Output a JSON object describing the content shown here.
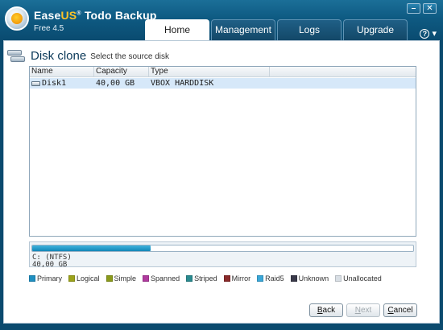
{
  "app": {
    "name_pre": "Ease",
    "name_accent": "US",
    "name_post": "Todo Backup",
    "version": "Free 4.5"
  },
  "window": {
    "minimize": "–",
    "close": "✕"
  },
  "tabs": [
    {
      "label": "Home",
      "active": true
    },
    {
      "label": "Management",
      "active": false
    },
    {
      "label": "Logs",
      "active": false
    },
    {
      "label": "Upgrade",
      "active": false
    }
  ],
  "help": {
    "glyph": "?",
    "caret": "▾"
  },
  "page": {
    "title": "Disk clone",
    "subtitle": "Select the source disk"
  },
  "table": {
    "columns": [
      "Name",
      "Capacity",
      "Type"
    ],
    "rows": [
      {
        "name": "Disk1",
        "capacity": "40,00 GB",
        "type": "VBOX HARDDISK",
        "selected": true
      }
    ]
  },
  "partition": {
    "label": "C: (NTFS)",
    "size": "40,00 GB",
    "fill_percent": 31
  },
  "legend": [
    {
      "label": "Primary",
      "color": "#1f8fc1"
    },
    {
      "label": "Logical",
      "color": "#9ca31a"
    },
    {
      "label": "Simple",
      "color": "#8a9a1a"
    },
    {
      "label": "Spanned",
      "color": "#b03a9e"
    },
    {
      "label": "Striped",
      "color": "#2a8a8f"
    },
    {
      "label": "Mirror",
      "color": "#8a2a2a"
    },
    {
      "label": "Raid5",
      "color": "#3aa7d8"
    },
    {
      "label": "Unknown",
      "color": "#3a3a4a"
    },
    {
      "label": "Unallocated",
      "color": "#d9dfe5"
    }
  ],
  "buttons": {
    "back_u": "B",
    "back_rest": "ack",
    "next_u": "N",
    "next_rest": "ext",
    "cancel_u": "C",
    "cancel_rest": "ancel"
  }
}
